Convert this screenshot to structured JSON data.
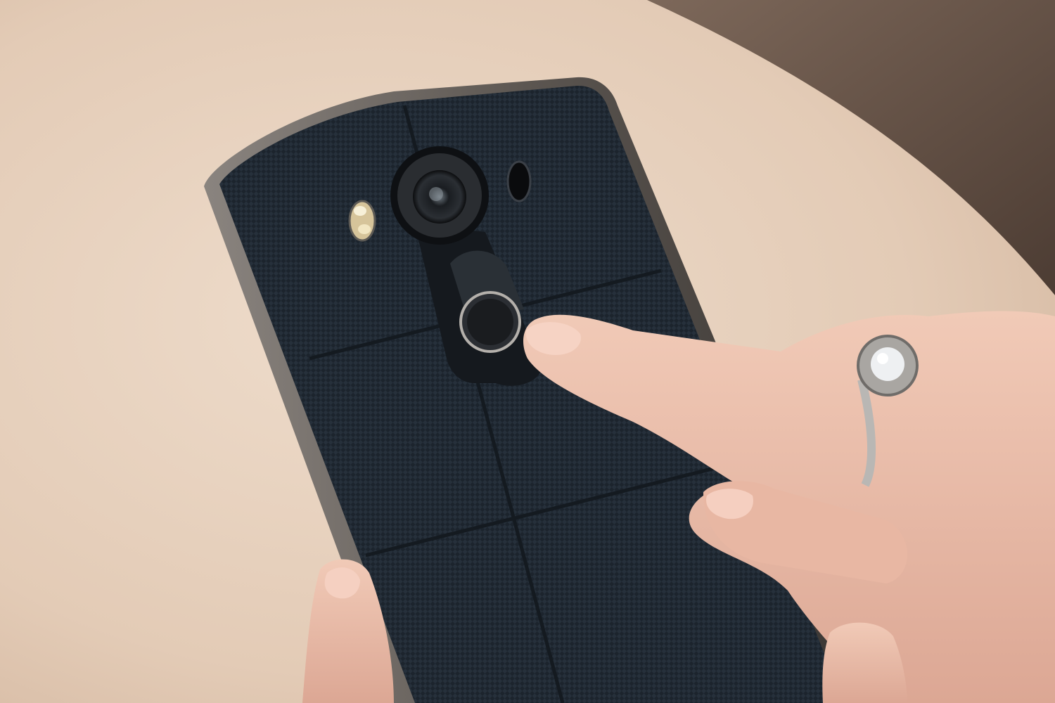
{
  "scene": {
    "subject": "smartphone-back-with-finger",
    "colors": {
      "table": "#e7d3c1",
      "background_dark": "#5e4d42",
      "phone_back": "#232c36",
      "phone_frame": "#6b6560",
      "skin": "#edc1ad",
      "ring": "#c7c5c2"
    }
  }
}
